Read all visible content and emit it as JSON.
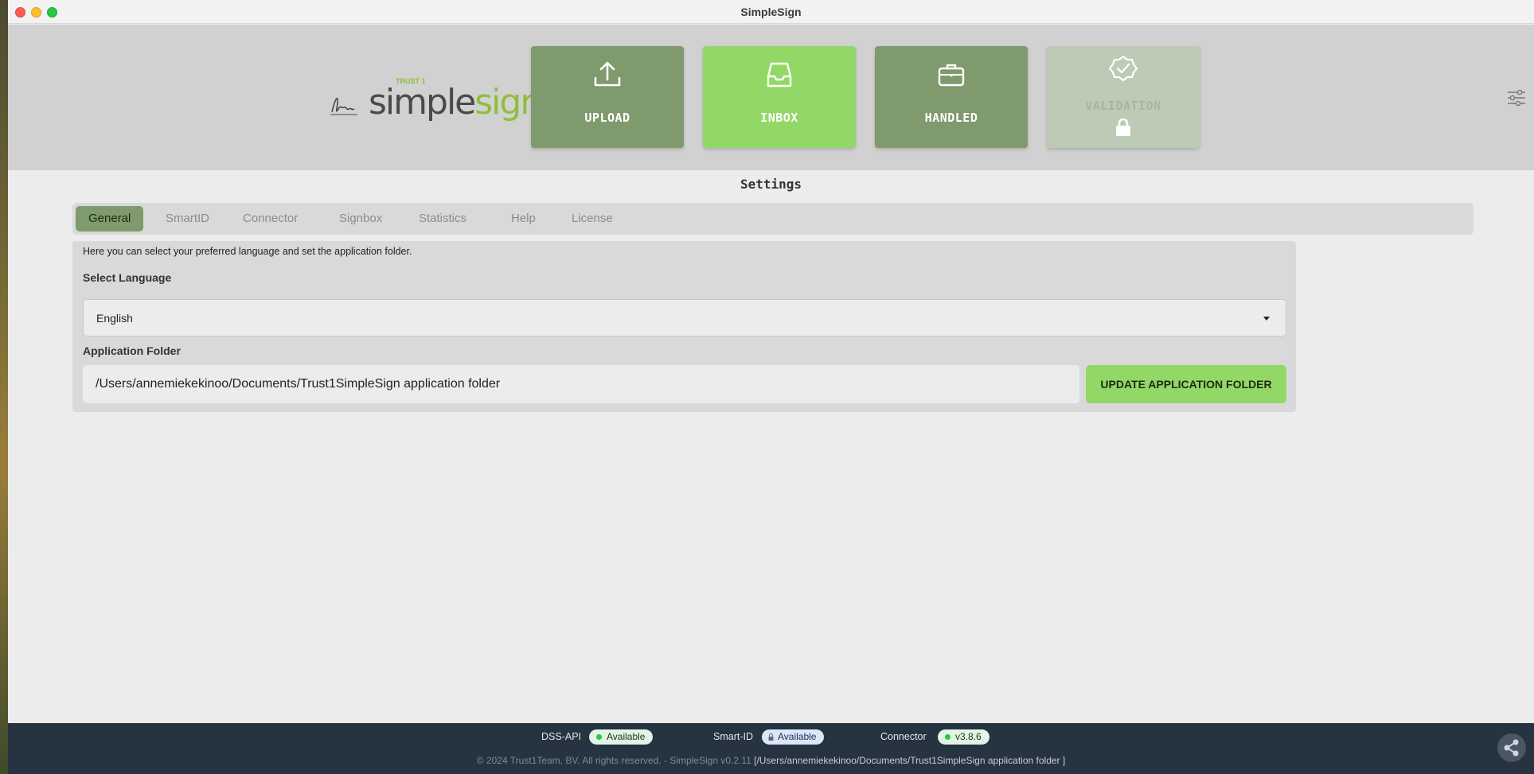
{
  "window": {
    "title": "SimpleSign"
  },
  "logo": {
    "trust": "TRUST 1",
    "brand_prefix": "simple",
    "brand_suffix": "sign"
  },
  "nav": {
    "upload": "UPLOAD",
    "inbox": "INBOX",
    "handled": "HANDLED",
    "validation": "VALIDATION"
  },
  "page": {
    "title": "Settings"
  },
  "tabs": [
    "General",
    "SmartID",
    "Connector",
    "Signbox",
    "Statistics",
    "Help",
    "License"
  ],
  "active_tab": "General",
  "general": {
    "description": "Here you can select your preferred language and set the application folder.",
    "language_label": "Select Language",
    "language_value": "English",
    "folder_label": "Application Folder",
    "folder_value": "/Users/annemiekekinoo/Documents/Trust1SimpleSign application folder",
    "update_button": "UPDATE APPLICATION FOLDER"
  },
  "footer": {
    "dss_label": "DSS-API",
    "dss_status": "Available",
    "smartid_label": "Smart-ID",
    "smartid_status": "Available",
    "connector_label": "Connector",
    "connector_status": "v3.8.6",
    "copyright": "© 2024 Trust1Team, BV. All rights reserved. - SimpleSign v0.2.11",
    "path": "[/Users/annemiekekinoo/Documents/Trust1SimpleSign application folder ]"
  },
  "colors": {
    "nav_green": "#7f9a6c",
    "active_green": "#93d866",
    "disabled_green": "#bdcab5",
    "footer_bg": "#263340"
  },
  "icons": [
    "upload-icon",
    "inbox-icon",
    "briefcase-icon",
    "badge-check-icon",
    "lock-icon",
    "sliders-icon",
    "share-icon"
  ]
}
